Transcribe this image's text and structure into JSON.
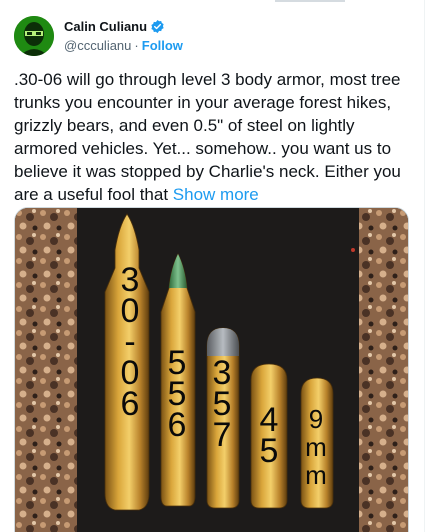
{
  "author": {
    "display_name": "Calin Culianu",
    "handle": "@ccculianu",
    "separator": "·",
    "follow_label": "Follow",
    "verified": true
  },
  "tweet": {
    "text": ".30-06 will go through level 3 body armor, most tree trunks you encounter in your average forest hikes, grizzly bears, and even 0.5\" of steel on lightly armored vehicles. Yet... somehow.. you want us to believe it was stopped by Charlie's neck. Either you are a useful fool that",
    "show_more_label": "Show more"
  },
  "media": {
    "calibers": [
      "3 0 - 0 6",
      "5 5 6",
      "3 5 7",
      "4 5",
      "9 m m"
    ]
  },
  "colors": {
    "link": "#1d9bf0",
    "muted": "#536471",
    "text": "#0f1419"
  }
}
